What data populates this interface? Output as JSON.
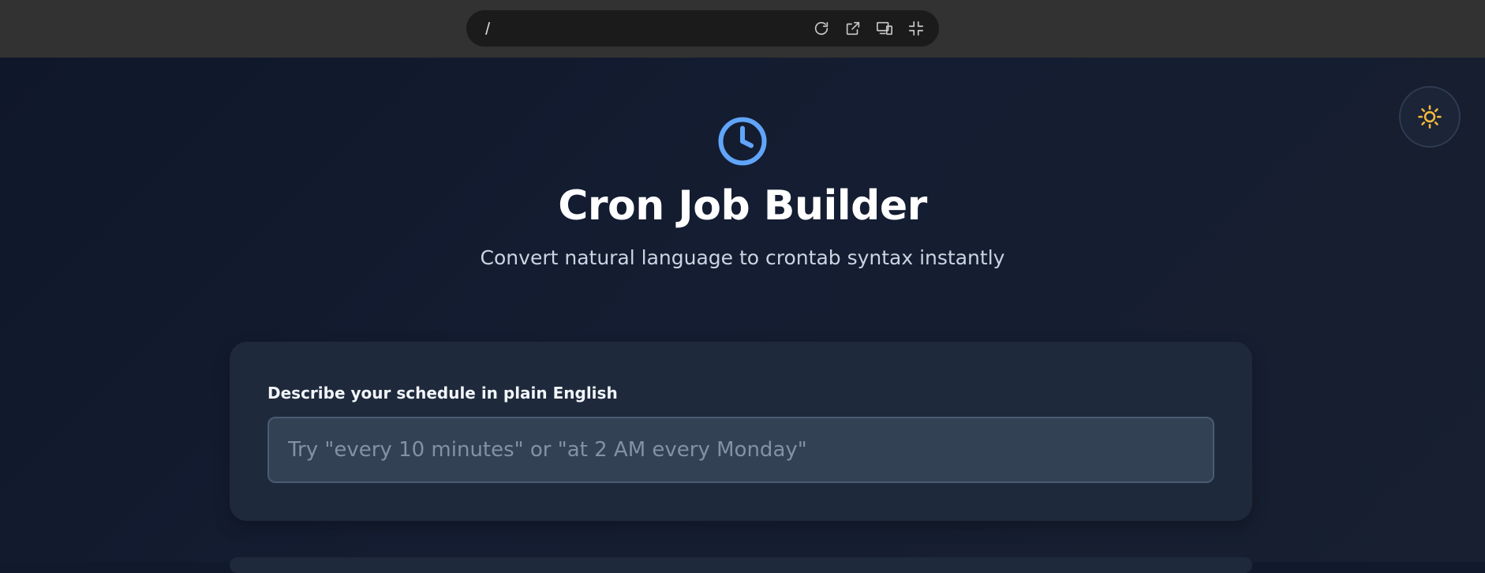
{
  "topbar": {
    "url": "/",
    "actions": [
      {
        "icon": "reload-icon"
      },
      {
        "icon": "open-external-icon"
      },
      {
        "icon": "device-preview-icon"
      },
      {
        "icon": "collapse-icon"
      }
    ]
  },
  "header": {
    "icon": "clock-icon",
    "title": "Cron Job Builder",
    "subtitle": "Convert natural language to crontab syntax instantly"
  },
  "theme_toggle": {
    "icon": "sun-icon",
    "color": "#f6b93b"
  },
  "form": {
    "label": "Describe your schedule in plain English",
    "input_value": "",
    "placeholder": "Try \"every 10 minutes\" or \"at 2 AM every Monday\""
  },
  "colors": {
    "accent": "#60a5fa",
    "background": "#0f172a",
    "card": "#1e293b",
    "input": "#334155"
  }
}
